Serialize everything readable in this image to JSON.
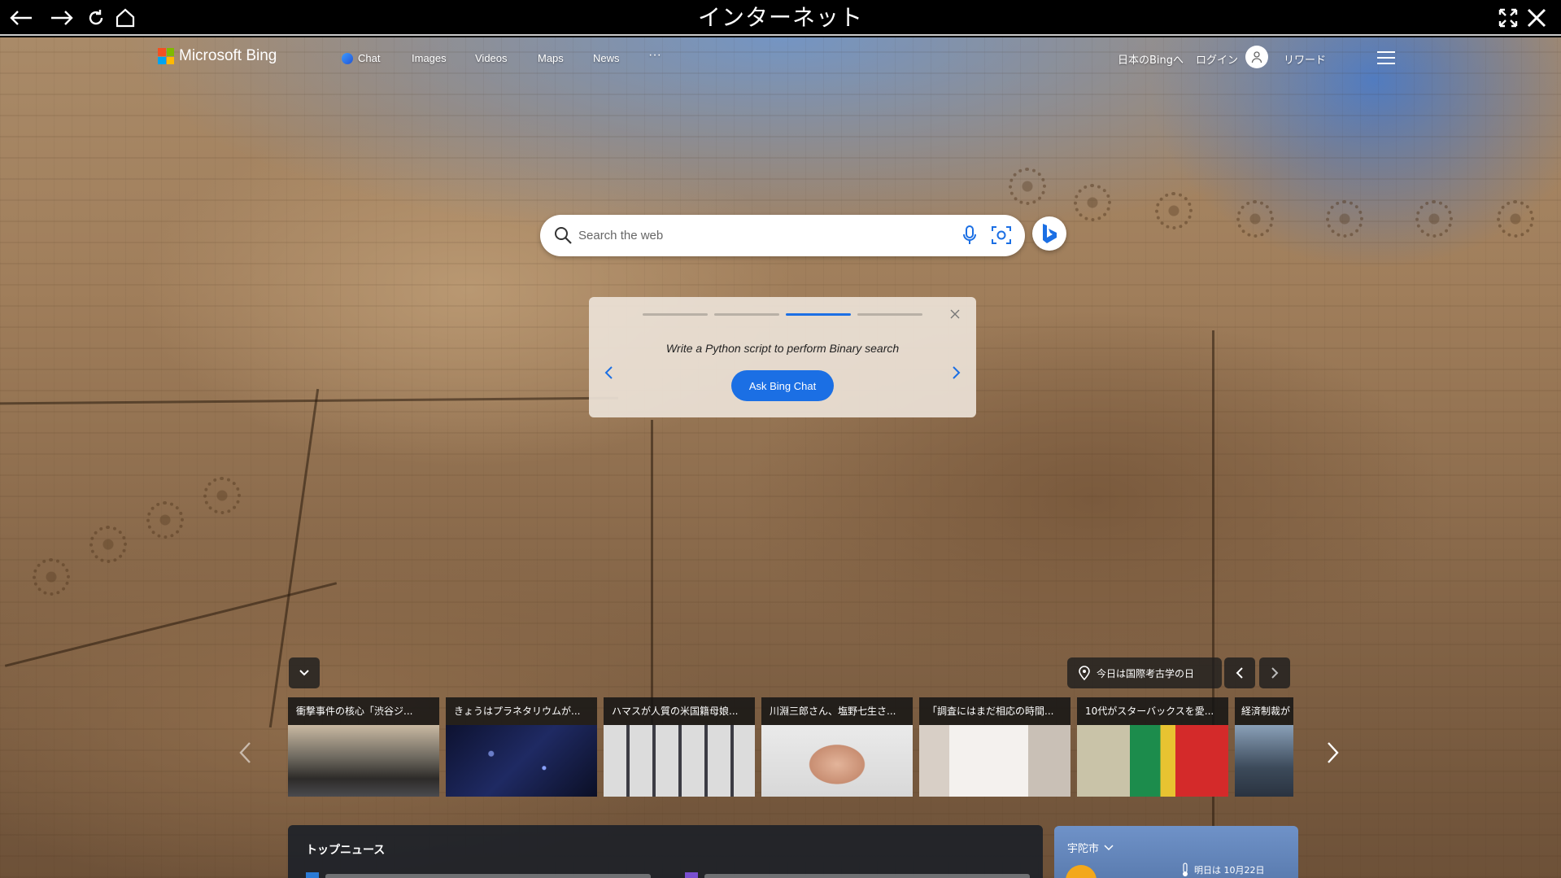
{
  "browser": {
    "title": "インターネット"
  },
  "header": {
    "logo_text": "Microsoft Bing",
    "nav": [
      "Chat",
      "Images",
      "Videos",
      "Maps",
      "News",
      "···"
    ],
    "region_link": "日本のBingへ",
    "login": "ログイン",
    "rewards": "リワード"
  },
  "search": {
    "placeholder": "Search the web"
  },
  "suggestion": {
    "text": "Write a Python script to perform Binary search",
    "button": "Ask Bing Chat"
  },
  "fact": {
    "label": "今日は国際考古学の日"
  },
  "news": [
    {
      "caption": "衝撃事件の核心「渋谷ジ...",
      "icon": "crowd-photo"
    },
    {
      "caption": "きょうはプラネタリウムが...",
      "icon": "planetarium-photo"
    },
    {
      "caption": "ハマスが人質の米国籍母娘...",
      "icon": "hostage-photos"
    },
    {
      "caption": "川淵三郎さん、塩野七生さ...",
      "icon": "portrait-photo"
    },
    {
      "caption": "「調査にはまだ相応の時間...",
      "icon": "notice-photo"
    },
    {
      "caption": "10代がスターバックスを愛...",
      "icon": "fashion-photo"
    },
    {
      "caption": "経済制裁が",
      "icon": "city-photo"
    }
  ],
  "top_news": {
    "title": "トップニュース"
  },
  "weather": {
    "location": "宇陀市",
    "forecast": "明日は 10月22日"
  },
  "colors": {
    "accent": "#1b6fe4",
    "ms_red": "#f25022",
    "ms_green": "#7fba00",
    "ms_blue": "#00a4ef",
    "ms_yellow": "#ffb900"
  }
}
